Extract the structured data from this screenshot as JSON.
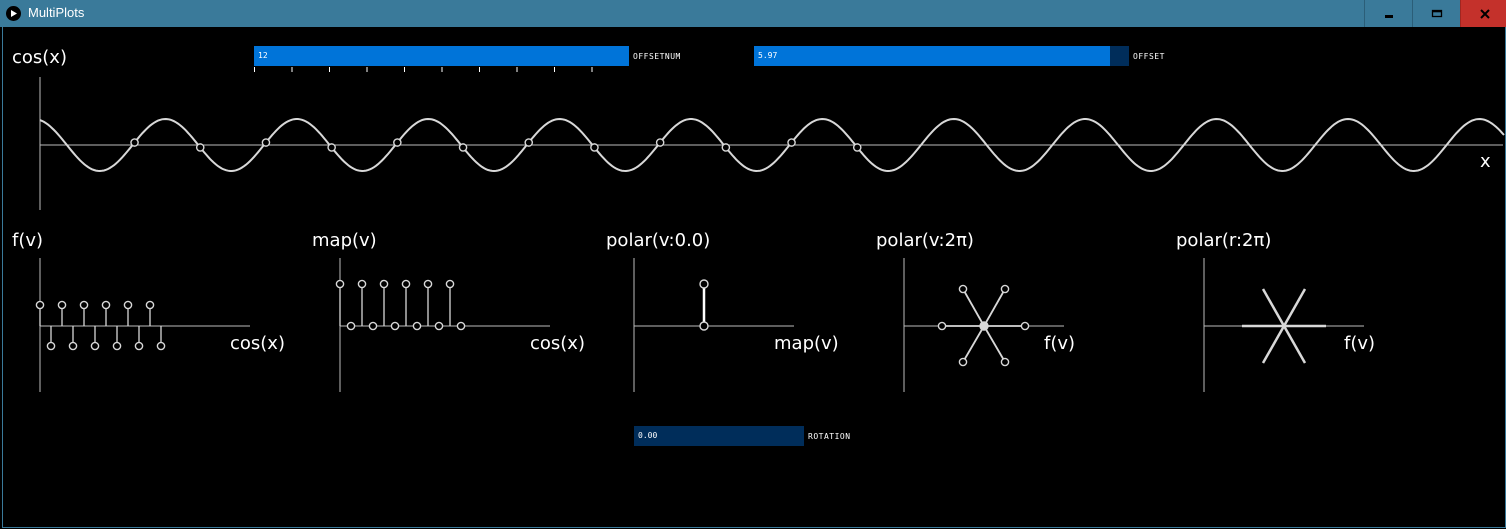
{
  "window": {
    "title": "MultiPlots",
    "buttons": [
      "minimize",
      "maximize",
      "close"
    ]
  },
  "controls": {
    "offsetnum": {
      "label": "OFFSETNUM",
      "value": "12",
      "fill_fraction": 1.0,
      "tick_count": 10
    },
    "offset": {
      "label": "OFFSET",
      "value": "5.97",
      "fill_fraction": 0.95
    },
    "rotation": {
      "label": "ROTATION",
      "value": "0.00",
      "fill_fraction": 0.0
    }
  },
  "plots": {
    "main": {
      "y_label": "cos(x)",
      "x_label": "x"
    },
    "f": {
      "title": "f(v)",
      "x_label": "cos(x)"
    },
    "map": {
      "title": "map(v)",
      "x_label": "cos(x)"
    },
    "polar_v": {
      "title": "polar(v:0.0)",
      "x_label": "map(v)"
    },
    "polar_v2pi": {
      "title": "polar(v:2π)",
      "x_label": "f(v)"
    },
    "polar_r2pi": {
      "title": "polar(r:2π)",
      "x_label": "f(v)"
    }
  },
  "colors": {
    "titlebar": "#3a7a9a",
    "close_button": "#c4312b",
    "slider_fill": "#0074d9",
    "slider_track": "#002d5a",
    "plot_line": "#d8d8d8"
  },
  "icons": [
    "play-app-icon",
    "minimize-icon",
    "maximize-icon",
    "close-icon"
  ]
}
